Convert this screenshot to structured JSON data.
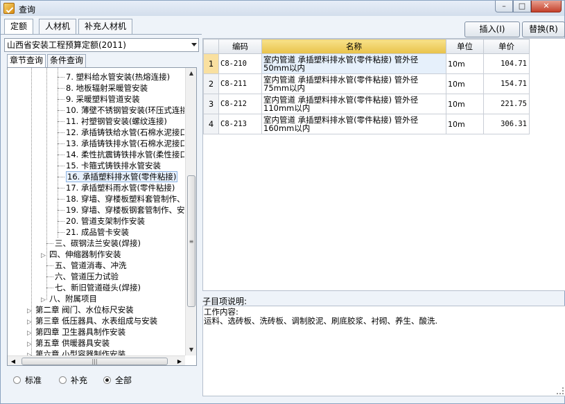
{
  "window": {
    "title": "查询",
    "min": "–",
    "max": "□",
    "close": "✕"
  },
  "top_tabs": [
    "定额",
    "人材机",
    "补充人材机"
  ],
  "buttons": {
    "insert": "插入(I)",
    "replace": "替换(R)"
  },
  "combo": {
    "value": "山西省安装工程预算定额(2011)"
  },
  "sub_tabs": [
    "章节查询",
    "条件查询"
  ],
  "tree": [
    {
      "label": "7. 塑料给水管安装(热熔连接)"
    },
    {
      "label": "8. 地板辐射采暖管安装"
    },
    {
      "label": "9. 采暖塑料管道安装"
    },
    {
      "label": "10. 薄壁不锈钢管安装(环压式连接"
    },
    {
      "label": "11. 衬塑钢管安装(螺纹连接)"
    },
    {
      "label": "12. 承插铸铁给水管(石棉水泥接口"
    },
    {
      "label": "13. 承插铸铁排水管(石棉水泥接口"
    },
    {
      "label": "14. 柔性抗震铸铁排水管(柔性接口"
    },
    {
      "label": "15. 卡箍式铸铁排水管安装"
    },
    {
      "label": "16. 承插塑料排水管(零件粘接)"
    },
    {
      "label": "17. 承插塑料雨水管(零件粘接)"
    },
    {
      "label": "18. 穿墙、穿楼板塑料套管制作、"
    },
    {
      "label": "19. 穿墙、穿楼板钢套管制作、安"
    },
    {
      "label": "20. 管道支架制作安装"
    },
    {
      "label": "21. 成品管卡安装"
    },
    {
      "label": "三、碳钢法兰安装(焊接)"
    },
    {
      "label": "四、伸缩器制作安装"
    },
    {
      "label": "五、管道消毒、冲洗"
    },
    {
      "label": "六、管道压力试验"
    },
    {
      "label": "七、新旧管道碰头(焊接)"
    },
    {
      "label": "八、附属项目"
    },
    {
      "label": "第二章 阀门、水位标尺安装"
    },
    {
      "label": "第三章 低压器具、水表组成与安装"
    },
    {
      "label": "第四章 卫生器具制作安装"
    },
    {
      "label": "第五章 供暖器具安装"
    },
    {
      "label": "第六章 小型容器制作安装"
    }
  ],
  "radios": [
    "标准",
    "补充",
    "全部"
  ],
  "table": {
    "headers": [
      "编码",
      "名称",
      "单位",
      "单价"
    ],
    "rows": [
      {
        "idx": "1",
        "code": "C8-210",
        "name": "室内管道 承插塑料排水管(零件粘接) 管外径 50mm以内",
        "unit": "10m",
        "price": "104.71"
      },
      {
        "idx": "2",
        "code": "C8-211",
        "name": "室内管道 承插塑料排水管(零件粘接) 管外径 75mm以内",
        "unit": "10m",
        "price": "154.71"
      },
      {
        "idx": "3",
        "code": "C8-212",
        "name": "室内管道 承插塑料排水管(零件粘接) 管外径 110mm以内",
        "unit": "10m",
        "price": "221.75"
      },
      {
        "idx": "4",
        "code": "C8-213",
        "name": "室内管道 承插塑料排水管(零件粘接) 管外径 160mm以内",
        "unit": "10m",
        "price": "306.31"
      }
    ]
  },
  "description": {
    "label": "子目项说明:",
    "line1": "工作内容:",
    "line2": "运料、选砖板、洗砖板、调制胶泥、刷底胶浆、衬砌、养生、酸洗."
  }
}
